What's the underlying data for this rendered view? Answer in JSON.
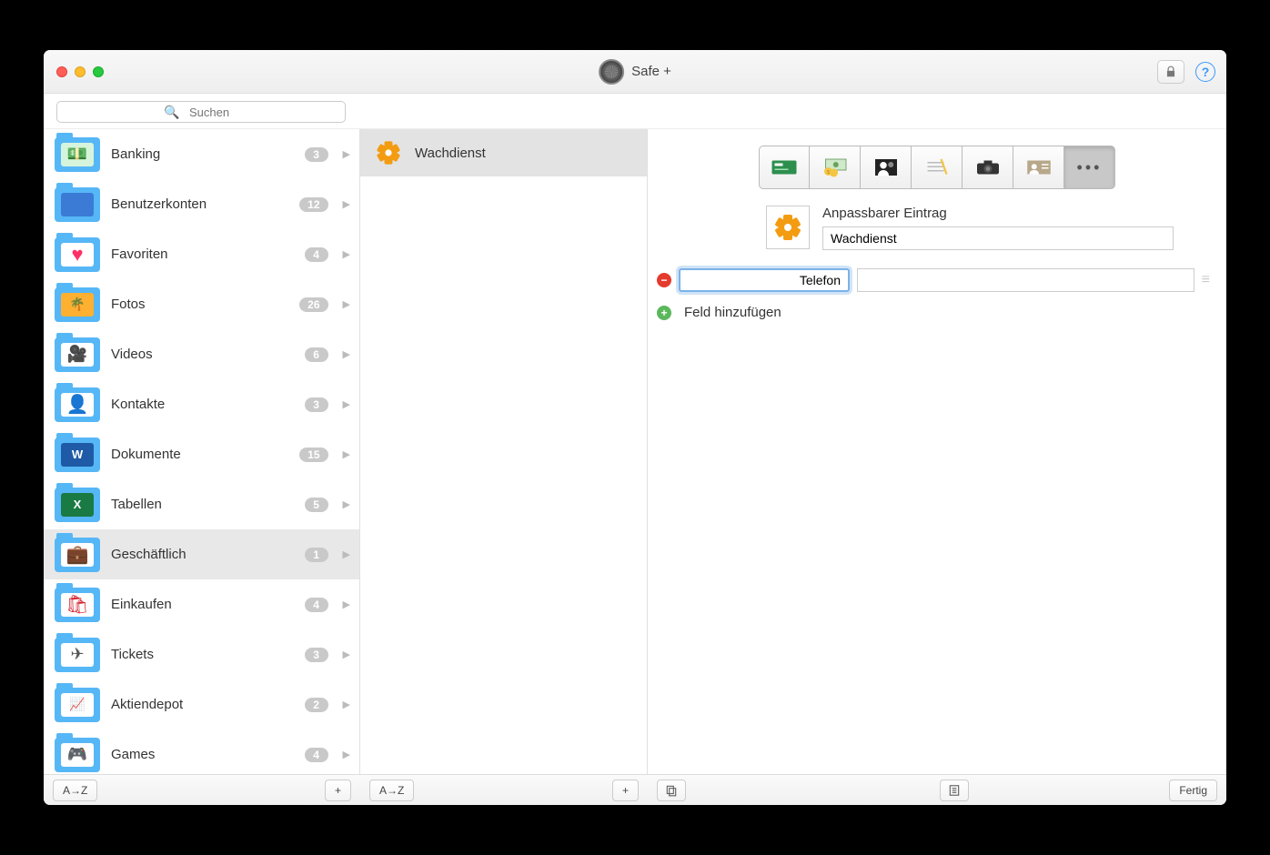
{
  "app": {
    "title": "Safe +"
  },
  "search": {
    "placeholder": "Suchen"
  },
  "categories": [
    {
      "id": "banking",
      "label": "Banking",
      "count": "3",
      "icon": "bank"
    },
    {
      "id": "accounts",
      "label": "Benutzerkonten",
      "count": "12",
      "icon": "accounts"
    },
    {
      "id": "favorites",
      "label": "Favoriten",
      "count": "4",
      "icon": "heart"
    },
    {
      "id": "photos",
      "label": "Fotos",
      "count": "26",
      "icon": "photo"
    },
    {
      "id": "videos",
      "label": "Videos",
      "count": "6",
      "icon": "video"
    },
    {
      "id": "contacts",
      "label": "Kontakte",
      "count": "3",
      "icon": "contact"
    },
    {
      "id": "documents",
      "label": "Dokumente",
      "count": "15",
      "icon": "doc"
    },
    {
      "id": "tables",
      "label": "Tabellen",
      "count": "5",
      "icon": "table"
    },
    {
      "id": "business",
      "label": "Geschäftlich",
      "count": "1",
      "icon": "biz",
      "selected": true
    },
    {
      "id": "shopping",
      "label": "Einkaufen",
      "count": "4",
      "icon": "shop"
    },
    {
      "id": "tickets",
      "label": "Tickets",
      "count": "3",
      "icon": "ticket"
    },
    {
      "id": "stocks",
      "label": "Aktiendepot",
      "count": "2",
      "icon": "stock"
    },
    {
      "id": "games",
      "label": "Games",
      "count": "4",
      "icon": "game"
    }
  ],
  "entries": [
    {
      "label": "Wachdienst",
      "selected": true
    }
  ],
  "detail": {
    "type_label": "Anpassbarer Eintrag",
    "name": "Wachdienst",
    "fields": [
      {
        "label": "Telefon",
        "value": ""
      }
    ],
    "add_field_label": "Feld hinzufügen"
  },
  "footer": {
    "sort_label": "A→Z",
    "add_label": "+",
    "done_label": "Fertig"
  }
}
